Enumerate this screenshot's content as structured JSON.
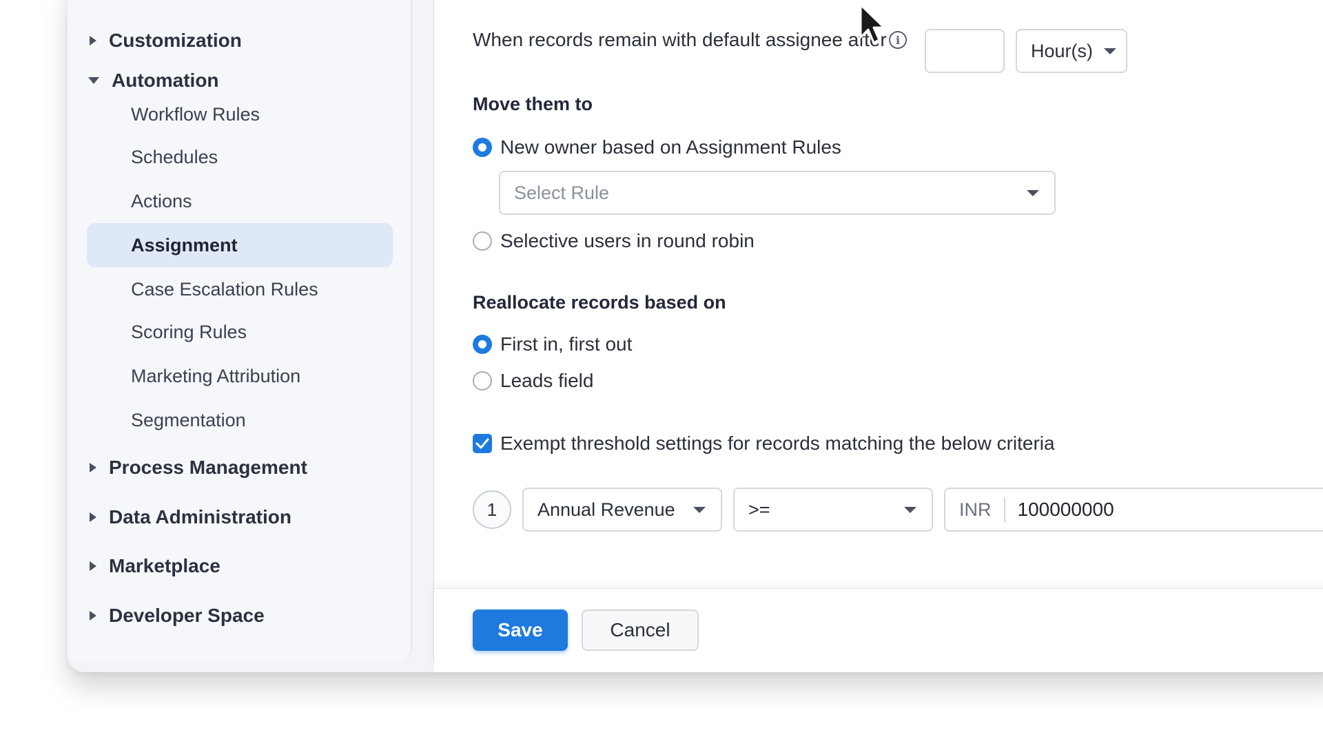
{
  "sidebar": {
    "groups": {
      "customization": "Customization",
      "automation": "Automation",
      "process_management": "Process Management",
      "data_administration": "Data Administration",
      "marketplace": "Marketplace",
      "developer_space": "Developer Space"
    },
    "automation_items": [
      {
        "label": "Workflow Rules"
      },
      {
        "label": "Schedules"
      },
      {
        "label": "Actions"
      },
      {
        "label": "Assignment"
      },
      {
        "label": "Case Escalation Rules"
      },
      {
        "label": "Scoring Rules"
      },
      {
        "label": "Marketing Attribution"
      },
      {
        "label": "Segmentation"
      }
    ],
    "active_item": "Assignment"
  },
  "form": {
    "threshold_text": "When records remain with default assignee after",
    "threshold_value": "",
    "threshold_unit": "Hour(s)",
    "move_heading": "Move them to",
    "move_options": {
      "assignment_rules": "New owner based on Assignment Rules",
      "round_robin": "Selective users in round robin"
    },
    "rule_select_placeholder": "Select Rule",
    "realloc_heading": "Reallocate records based on",
    "realloc_options": {
      "fifo": "First in, first out",
      "leads_field": "Leads field"
    },
    "exempt_label": "Exempt threshold settings for records matching the below criteria",
    "criteria": {
      "index": "1",
      "field": "Annual Revenue",
      "operator": ">=",
      "currency": "INR",
      "value": "100000000"
    }
  },
  "footer": {
    "save_label": "Save",
    "cancel_label": "Cancel"
  },
  "colors": {
    "accent": "#1f7ae0",
    "active_bg": "#dfe8f6"
  }
}
